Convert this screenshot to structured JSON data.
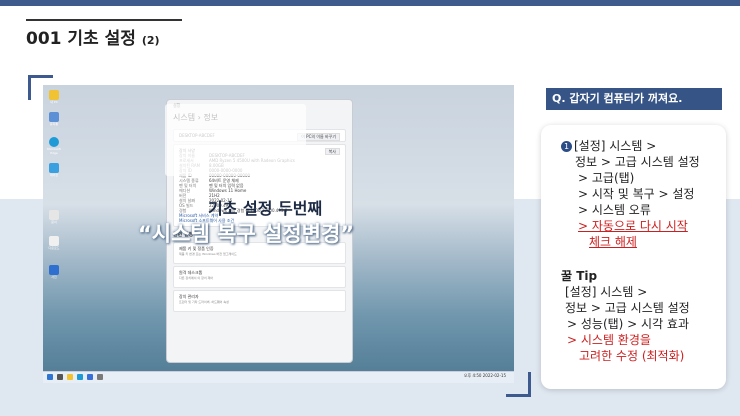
{
  "page": {
    "title": "001 기초 설정",
    "title_suffix": "(2)"
  },
  "overlay": {
    "title": "기초 설정 두번째",
    "subtitle": "“시스템 복구 설정변경”"
  },
  "desktop": {
    "icons": [
      "내 PC",
      "휴지통",
      "Microsoft Edge",
      "제어판",
      "문서",
      "다운로드",
      "사진"
    ],
    "tray_time": "오후 4:50",
    "tray_date": "2022-02-15"
  },
  "settings_window": {
    "header": "설정",
    "breadcrumb": "시스템 › 정보",
    "device_name": "DESKTOP-ABCDEF",
    "rename_button": "이 PC의 이름 바꾸기",
    "device_spec_title": "장치 사양",
    "copy_button": "복사",
    "spec_rows": [
      {
        "k": "장치 이름",
        "v": "DESKTOP-ABCDEF"
      },
      {
        "k": "프로세서",
        "v": "AMD Ryzen 5 4500U with Radeon Graphics"
      },
      {
        "k": "설치된 RAM",
        "v": "8.00GB"
      },
      {
        "k": "장치 ID",
        "v": "0000-0000-0000"
      },
      {
        "k": "제품 ID",
        "v": "00000-00000-00000"
      },
      {
        "k": "시스템 종류",
        "v": "64비트 운영 체제"
      },
      {
        "k": "펜 및 터치",
        "v": "펜 및 터치 입력 없음"
      }
    ],
    "win_rows": [
      {
        "k": "에디션",
        "v": "Windows 11 Home"
      },
      {
        "k": "버전",
        "v": "21H2"
      },
      {
        "k": "설치 날짜",
        "v": "2022-02-15"
      },
      {
        "k": "OS 빌드",
        "v": "22000.493"
      },
      {
        "k": "경험",
        "v": "Windows 기능 경험 팩 1000.22000.493.0"
      }
    ],
    "links": [
      "Microsoft 서비스 계약",
      "Microsoft 소프트웨어 사용 조건"
    ],
    "related_title": "관련 설정",
    "related_items": [
      {
        "title": "제품 키 및 정품 인증",
        "sub": "제품 키 변경 또는 Windows 버전 업그레이드"
      },
      {
        "title": "원격 데스크톱",
        "sub": "다른 장치에서 이 장치 제어"
      },
      {
        "title": "장치 관리자",
        "sub": "프린터 및 기타 드라이버, 하드웨어 속성"
      }
    ]
  },
  "right_panel": {
    "question": "Q. 갑자기 컴퓨터가 꺼져요.",
    "step_bullet": "1",
    "lines": [
      "[설정] 시스템 >",
      "정보 > 고급 시스템 설정",
      "> 고급(탭)",
      "> 시작 및 복구 > 설정",
      "> 시스템 오류",
      "> 자동으로 다시 시작",
      "체크 해제"
    ],
    "tip_title": "꿀 Tip",
    "tip_lines": [
      "[설정] 시스템 >",
      "정보 > 고급 시스템 설정",
      "> 성능(탭) > 시각 효과",
      "> 시스템 환경을",
      "고려한 수정 (최적화)"
    ]
  },
  "colors": {
    "accent": "#375486",
    "highlight": "#cc1f1f",
    "band": "#dfe7f1"
  }
}
